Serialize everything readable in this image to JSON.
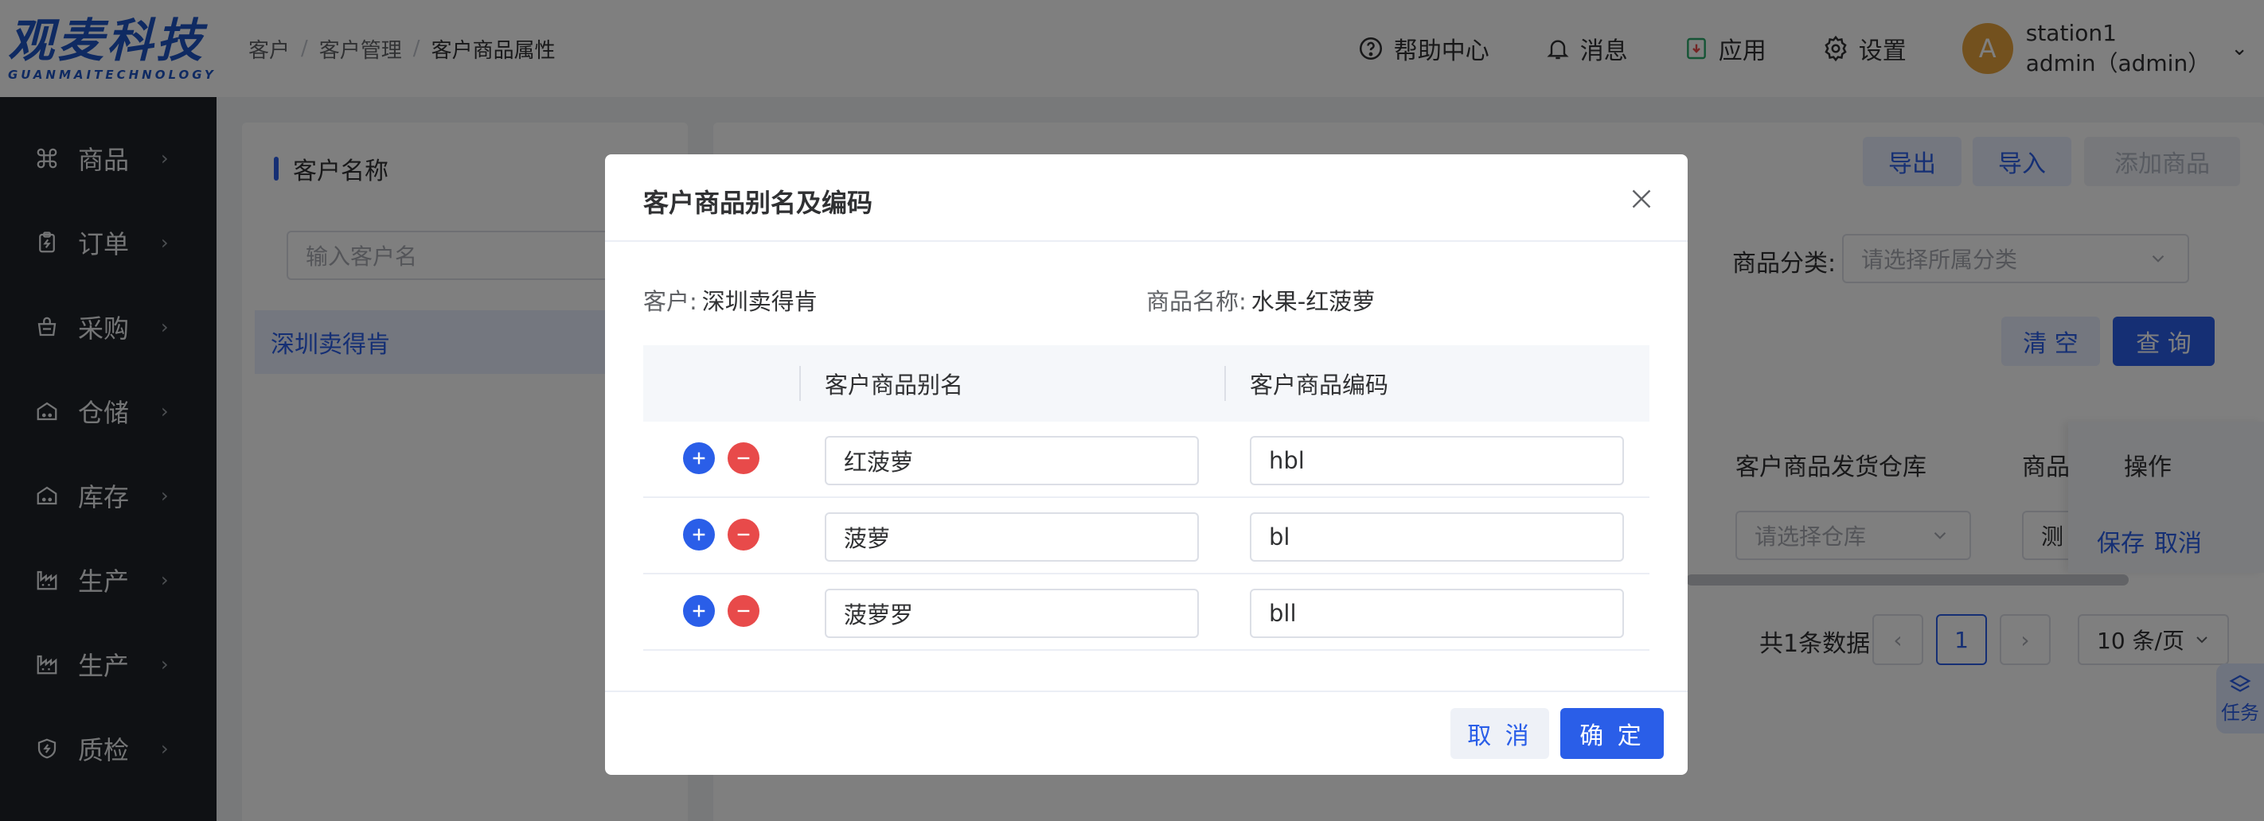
{
  "logo": {
    "main": "观麦科技",
    "sub": "GUANMAITECHNOLOGY"
  },
  "sidebar": {
    "items": [
      {
        "label": "商品",
        "icon": "command-icon"
      },
      {
        "label": "订单",
        "icon": "clipboard-icon"
      },
      {
        "label": "采购",
        "icon": "basket-icon"
      },
      {
        "label": "仓储",
        "icon": "warehouse-icon"
      },
      {
        "label": "库存",
        "icon": "warehouse-icon"
      },
      {
        "label": "生产",
        "icon": "factory-icon"
      },
      {
        "label": "生产",
        "icon": "factory-icon"
      },
      {
        "label": "质检",
        "icon": "shield-icon"
      }
    ]
  },
  "header": {
    "breadcrumb": [
      "客户",
      "客户管理",
      "客户商品属性"
    ],
    "help": "帮助中心",
    "messages": "消息",
    "apps": "应用",
    "settings": "设置",
    "user": {
      "avatar": "A",
      "station": "station1",
      "account": "admin（admin）"
    }
  },
  "left_panel": {
    "title": "客户名称",
    "search_placeholder": "输入客户名",
    "selected_customer": "深圳卖得肯"
  },
  "right_panel": {
    "buttons": {
      "export": "导出",
      "import": "导入",
      "add_product": "添加商品",
      "clear": "清 空",
      "query": "查 询"
    },
    "filter": {
      "category_label": "商品分类:",
      "category_placeholder": "请选择所属分类"
    },
    "table": {
      "headers": [
        "客户商品发货仓库",
        "商品",
        "操作"
      ],
      "warehouse_placeholder": "请选择仓库",
      "partial_cell": "测",
      "actions": {
        "save": "保存",
        "cancel": "取消"
      }
    },
    "pagination": {
      "total": "共1条数据",
      "current_page": "1",
      "page_size": "10 条/页"
    },
    "float_task": "任务"
  },
  "dialog": {
    "title": "客户商品别名及编码",
    "customer_label": "客户:",
    "customer_value": "深圳卖得肯",
    "product_label": "商品名称:",
    "product_value": "水果-红菠萝",
    "columns": [
      "客户商品别名",
      "客户商品编码"
    ],
    "rows": [
      {
        "alias": "红菠萝",
        "code": "hbl"
      },
      {
        "alias": "菠萝",
        "code": "bl"
      },
      {
        "alias": "菠萝罗",
        "code": "bll"
      }
    ],
    "cancel": "取 消",
    "confirm": "确 定"
  }
}
